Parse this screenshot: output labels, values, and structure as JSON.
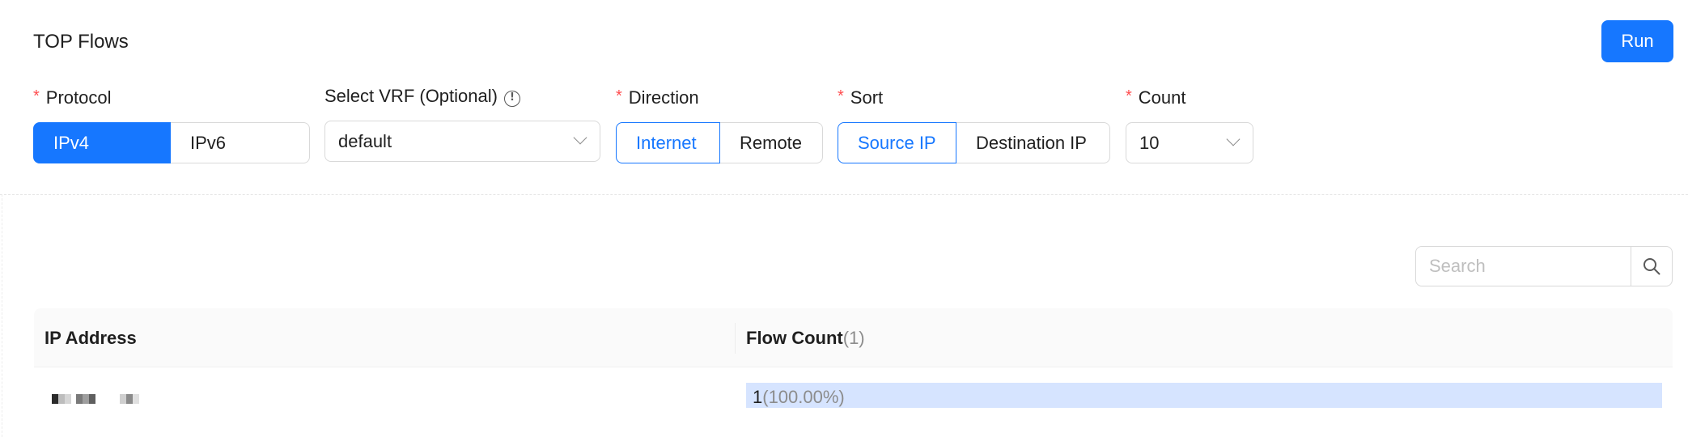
{
  "page": {
    "title": "TOP Flows",
    "run_label": "Run"
  },
  "form": {
    "required_mark": "*",
    "protocol": {
      "label": "Protocol",
      "options": [
        "IPv4",
        "IPv6"
      ],
      "selected": "IPv4"
    },
    "vrf": {
      "label": "Select VRF (Optional)",
      "info_icon": "info-circle-icon",
      "value": "default"
    },
    "direction": {
      "label": "Direction",
      "options": [
        "Internet",
        "Remote"
      ],
      "selected": "Internet"
    },
    "sort": {
      "label": "Sort",
      "options": [
        "Source IP",
        "Destination IP"
      ],
      "selected": "Source IP"
    },
    "count": {
      "label": "Count",
      "value": "10"
    }
  },
  "search": {
    "placeholder": "Search",
    "icon": "search-icon"
  },
  "table": {
    "columns": {
      "ip": "IP Address",
      "flow": "Flow Count",
      "flow_total": "(1)"
    },
    "rows": [
      {
        "ip": "",
        "flow_value": "1",
        "flow_pct": "(100.00%)",
        "fraction": 1.0
      }
    ]
  },
  "colors": {
    "primary": "#1677ff",
    "required": "#ff4d4f",
    "bar": "#d6e4ff",
    "muted": "#8c8c8c"
  }
}
